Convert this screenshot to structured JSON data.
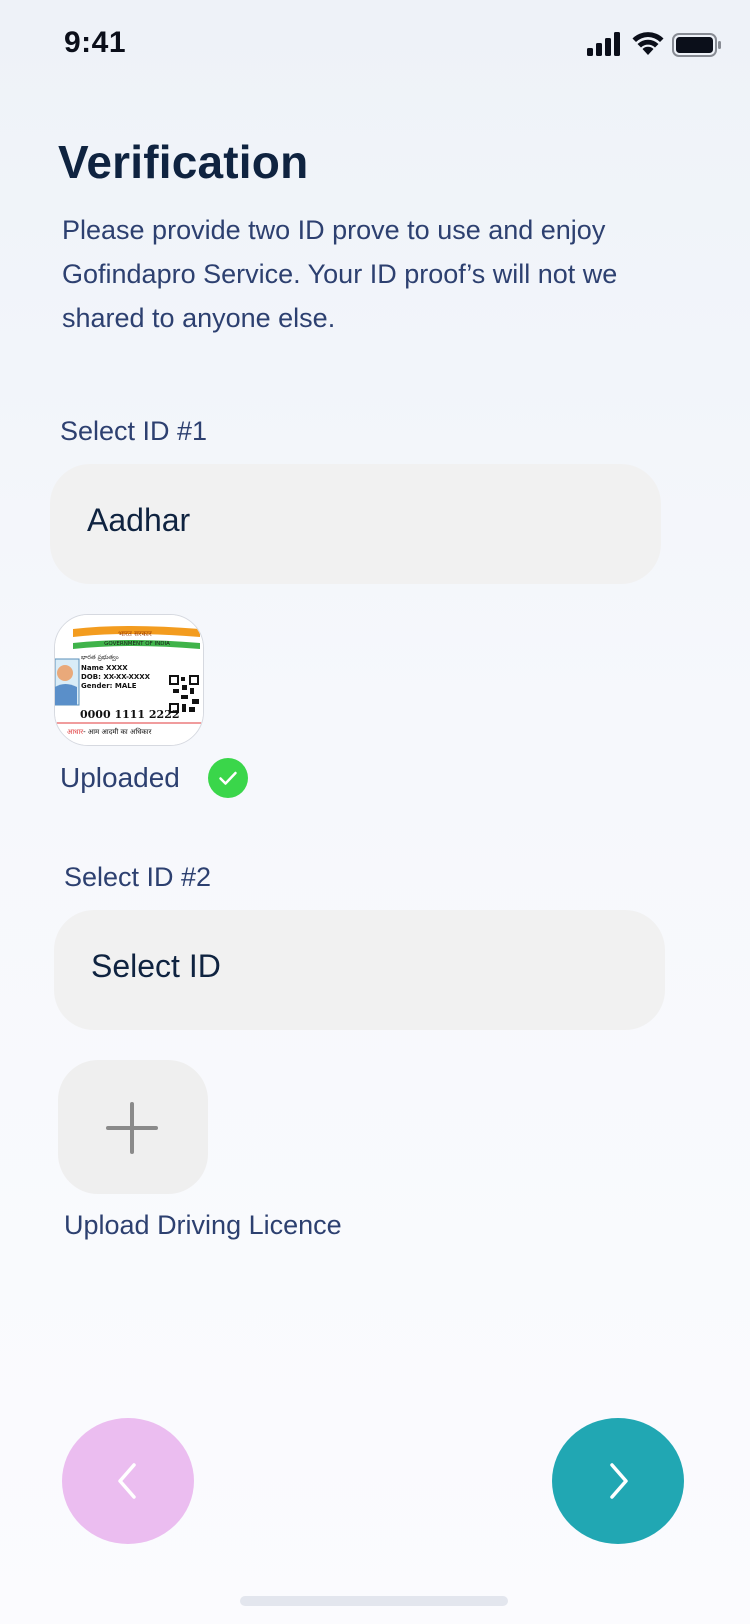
{
  "status_bar": {
    "time": "9:41",
    "icons": [
      "signal-icon",
      "wifi-icon",
      "battery-icon"
    ]
  },
  "header": {
    "title": "Verification",
    "description": "Please provide two ID prove to use and enjoy Gofindapro Service. Your ID proof’s will not we shared to anyone else."
  },
  "id1": {
    "label": "Select ID #1",
    "value": "Aadhar",
    "card": {
      "header_hindi": "भारत सरकार",
      "header_english": "GOVERNMENT OF INDIA",
      "regional": "భారత ప్రభుత్వం",
      "name_line": "Name XXXX",
      "dob_line": "DOB: XX-XX-XXXX",
      "gender_line": "Gender: MALE",
      "number": "0000 1111 2222",
      "footer_red": "आधार",
      "footer_rest": "- आम आदमी का अधिकार"
    },
    "status": "Uploaded",
    "status_icon": "check-circle-icon"
  },
  "id2": {
    "label": "Select ID #2",
    "placeholder": "Select ID",
    "upload_caption": "Upload Driving Licence",
    "upload_icon": "plus-icon"
  },
  "navigation": {
    "back_icon": "chevron-left-icon",
    "next_icon": "chevron-right-icon"
  },
  "colors": {
    "title": "#0f2340",
    "body_text": "#2d4070",
    "field_bg": "#f1f1f1",
    "success": "#3ad64a",
    "back_button": "#ebbdf0",
    "next_button": "#21a7b3"
  }
}
